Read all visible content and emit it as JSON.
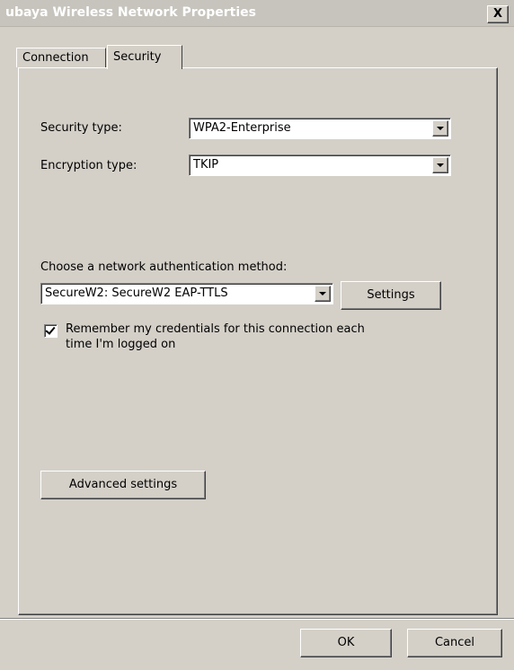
{
  "window": {
    "title": "ubaya Wireless Network Properties",
    "close_label": "X"
  },
  "tabs": [
    {
      "label": "Connection",
      "active": false
    },
    {
      "label": "Security",
      "active": true
    }
  ],
  "security": {
    "security_type_label": "Security type:",
    "security_type_value": "WPA2-Enterprise",
    "encryption_type_label": "Encryption type:",
    "encryption_type_value": "TKIP",
    "auth_method_label": "Choose a network authentication method:",
    "auth_method_value": "SecureW2: SecureW2 EAP-TTLS",
    "settings_button": "Settings",
    "remember_line1": "Remember my credentials for this connection each",
    "remember_line2": "time I'm logged on",
    "remember_checked": true,
    "advanced_button": "Advanced settings"
  },
  "footer": {
    "ok_button": "OK",
    "cancel_button": "Cancel"
  },
  "colors": {
    "dialog_bg": "#d4d0c8",
    "title_text": "#ffffff"
  },
  "icons": {
    "close": "close-icon",
    "dropdown": "chevron-down-icon",
    "check": "checkmark-icon"
  }
}
